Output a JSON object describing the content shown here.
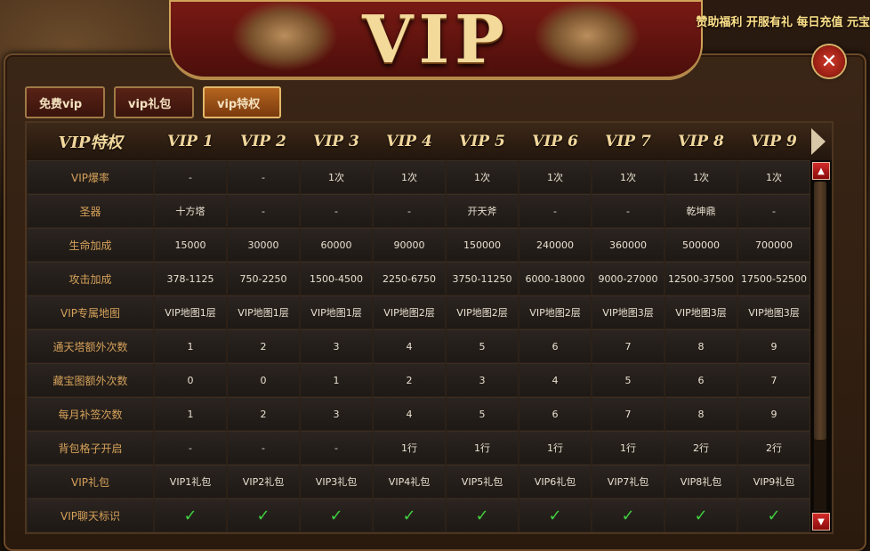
{
  "header": {
    "title": "VIP",
    "promo_text": "赞助福利 开服有礼 每日充值 元宝"
  },
  "close_icon": "close-icon",
  "tabs": [
    {
      "label": "免费vip"
    },
    {
      "label": "vip礼包"
    },
    {
      "label": "vip特权"
    }
  ],
  "table": {
    "header_label": "VIP特权",
    "columns": [
      "VIP 1",
      "VIP 2",
      "VIP 3",
      "VIP 4",
      "VIP 5",
      "VIP 6",
      "VIP 7",
      "VIP 8",
      "VIP 9"
    ],
    "rows": [
      {
        "label": "VIP爆率",
        "values": [
          "-",
          "-",
          "1次",
          "1次",
          "1次",
          "1次",
          "1次",
          "1次",
          "1次"
        ]
      },
      {
        "label": "圣器",
        "values": [
          "十方塔",
          "-",
          "-",
          "-",
          "开天斧",
          "-",
          "-",
          "乾坤鼎",
          "-"
        ]
      },
      {
        "label": "生命加成",
        "values": [
          "15000",
          "30000",
          "60000",
          "90000",
          "150000",
          "240000",
          "360000",
          "500000",
          "700000"
        ]
      },
      {
        "label": "攻击加成",
        "values": [
          "378-1125",
          "750-2250",
          "1500-4500",
          "2250-6750",
          "3750-11250",
          "6000-18000",
          "9000-27000",
          "12500-37500",
          "17500-52500"
        ]
      },
      {
        "label": "VIP专属地图",
        "values": [
          "VIP地图1层",
          "VIP地图1层",
          "VIP地图1层",
          "VIP地图2层",
          "VIP地图2层",
          "VIP地图2层",
          "VIP地图3层",
          "VIP地图3层",
          "VIP地图3层"
        ]
      },
      {
        "label": "通天塔额外次数",
        "values": [
          "1",
          "2",
          "3",
          "4",
          "5",
          "6",
          "7",
          "8",
          "9"
        ]
      },
      {
        "label": "藏宝图额外次数",
        "values": [
          "0",
          "0",
          "1",
          "2",
          "3",
          "4",
          "5",
          "6",
          "7"
        ]
      },
      {
        "label": "每月补签次数",
        "values": [
          "1",
          "2",
          "3",
          "4",
          "5",
          "6",
          "7",
          "8",
          "9"
        ]
      },
      {
        "label": "背包格子开启",
        "values": [
          "-",
          "-",
          "-",
          "1行",
          "1行",
          "1行",
          "1行",
          "2行",
          "2行"
        ]
      },
      {
        "label": "VIP礼包",
        "values": [
          "VIP1礼包",
          "VIP2礼包",
          "VIP3礼包",
          "VIP4礼包",
          "VIP5礼包",
          "VIP6礼包",
          "VIP7礼包",
          "VIP8礼包",
          "VIP9礼包"
        ]
      },
      {
        "label": "VIP聊天标识",
        "values": [
          "✓",
          "✓",
          "✓",
          "✓",
          "✓",
          "✓",
          "✓",
          "✓",
          "✓"
        ]
      }
    ]
  },
  "colors": {
    "accent": "#d5a15a",
    "check": "#3fcf3f",
    "close": "#d23a2a",
    "active_tab": "#b5651e"
  }
}
